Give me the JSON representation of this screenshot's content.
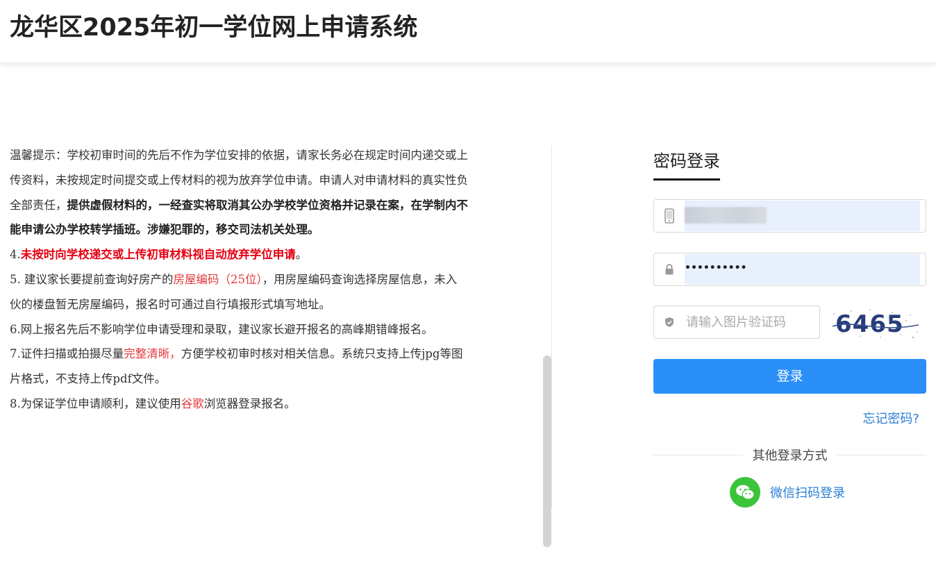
{
  "header": {
    "title": "龙华区2025年初一学位网上申请系统"
  },
  "notice": {
    "p1_normal": "温馨提示：学校初审时间的先后不作为学位安排的依据，请家长务必在规定时间内递交或上传资料，未按规定时间提交或上传材料的视为放弃学位申请。申请人对申请材料的真实性负全部责任，",
    "p1_bold": "提供虚假材料的，一经查实将取消其公办学校学位资格并记录在案，在学制内不能申请公办学校转学插班。涉嫌犯罪的，移交司法机关处理。",
    "p4_num": "4.",
    "p4_red": "未按时向学校递交或上传初审材料视自动放弃学位申请",
    "p4_end": "。",
    "p5_a": "5. 建议家长要提前查询好房产的",
    "p5_red": "房屋编码（25位）",
    "p5_b": "，用房屋编码查询选择房屋信息，未入伙的楼盘暂无房屋编码，报名时可通过自行填报形式填写地址。",
    "p6": "6.网上报名先后不影响学位申请受理和录取，建议家长避开报名的高峰期错峰报名。",
    "p7_a": "7.证件扫描或拍摄尽量",
    "p7_red": "完整清晰，",
    "p7_b": "方便学校初审时核对相关信息。系统只支持上传jpg等图片格式，不支持上传pdf文件。",
    "p8_a": "8.为保证学位申请顺利，建议使用",
    "p8_red": "谷歌",
    "p8_b": "浏览器登录报名。"
  },
  "login": {
    "title": "密码登录",
    "password_mask": "••••••••••",
    "captcha_placeholder": "请输入图片验证码",
    "captcha_code": "6465",
    "submit_label": "登录",
    "forgot_label": "忘记密码?",
    "other_methods_label": "其他登录方式",
    "wechat_label": "微信扫码登录"
  },
  "colors": {
    "accent": "#2a8ff7",
    "link": "#2a7fd4",
    "warning_red": "#e4393c",
    "wechat_green": "#3bc43a",
    "autofill_bg": "#e8f0fe"
  },
  "icons": [
    "mobile-phone-icon",
    "lock-icon",
    "shield-icon",
    "wechat-icon"
  ]
}
